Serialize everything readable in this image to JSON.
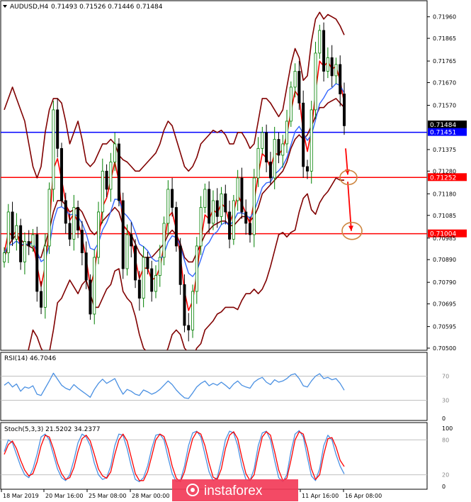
{
  "header": {
    "symbol": "AUDUSD,H4",
    "ohlc": "0.71493 0.71526 0.71446 0.71484",
    "arrow_icon": "triangle-down-icon"
  },
  "rsi_label": "RSI(14) 46.7046",
  "stoch_label": "Stoch(5,3,3) 21.5202 34.2377",
  "watermark": "instaforex",
  "colors": {
    "bull_candle": "#008000",
    "bear_candle": "#000000",
    "bollinger": "#800000",
    "ma_fast": "#ff0000",
    "ma_slow": "#3366ff",
    "level_blue": "#0000ff",
    "level_red": "#ff0000",
    "rsi_line": "#4a90e2",
    "stoch_main": "#4a90e2",
    "stoch_signal": "#ff0000",
    "annotation": "#cd853f",
    "watermark_bg": "#f23b58"
  },
  "chart_data": {
    "type": "candlestick",
    "price_axis": {
      "ylim": [
        0.705,
        0.71984
      ],
      "ticks": [
        "0.71960",
        "0.71865",
        "0.71765",
        "0.71670",
        "0.71570",
        "0.71375",
        "0.71280",
        "0.71180",
        "0.71085",
        "0.70985",
        "0.70890",
        "0.70790",
        "0.70695",
        "0.70595",
        "0.70500"
      ]
    },
    "price_tags": [
      {
        "text": "0.71484",
        "value": 0.71484,
        "style": "black"
      },
      {
        "text": "0.71451",
        "value": 0.71451,
        "style": "blue"
      },
      {
        "text": "0.71252",
        "value": 0.71252,
        "style": "red"
      },
      {
        "text": "0.71004",
        "value": 0.71004,
        "style": "red"
      }
    ],
    "horizontal_levels": [
      {
        "value": 0.71451,
        "color": "blue"
      },
      {
        "value": 0.71252,
        "color": "red"
      },
      {
        "value": 0.71004,
        "color": "red"
      }
    ],
    "time_axis": [
      "18 Mar 2019",
      "20 Mar 16:00",
      "25 Mar 08:00",
      "28 Mar 00:00",
      "11 Apr 16:00",
      "16 Apr 08:00"
    ],
    "closes": [
      0.7092,
      0.711,
      0.7098,
      0.7104,
      0.7088,
      0.7097,
      0.7095,
      0.71,
      0.7075,
      0.7068,
      0.7095,
      0.712,
      0.7155,
      0.7138,
      0.7115,
      0.7105,
      0.7098,
      0.7112,
      0.7102,
      0.7092,
      0.708,
      0.7065,
      0.709,
      0.711,
      0.7128,
      0.712,
      0.7132,
      0.714,
      0.7115,
      0.7085,
      0.71,
      0.7095,
      0.708,
      0.7072,
      0.709,
      0.7085,
      0.7075,
      0.7082,
      0.709,
      0.7105,
      0.712,
      0.7112,
      0.7095,
      0.7078,
      0.706,
      0.7058,
      0.7075,
      0.7095,
      0.7112,
      0.712,
      0.7105,
      0.7115,
      0.7108,
      0.7118,
      0.711,
      0.7098,
      0.7115,
      0.7125,
      0.711,
      0.7105,
      0.71,
      0.7125,
      0.7138,
      0.7145,
      0.7132,
      0.7125,
      0.7142,
      0.7135,
      0.714,
      0.715,
      0.7165,
      0.7172,
      0.7158,
      0.713,
      0.7128,
      0.7155,
      0.718,
      0.719,
      0.7172,
      0.7178,
      0.717,
      0.7175,
      0.7162,
      0.7148
    ],
    "bands": {
      "upper": [
        0.7155,
        0.716,
        0.7165,
        0.716,
        0.7155,
        0.715,
        0.714,
        0.713,
        0.7125,
        0.713,
        0.7145,
        0.7155,
        0.716,
        0.716,
        0.7158,
        0.715,
        0.714,
        0.7145,
        0.715,
        0.7142,
        0.7132,
        0.713,
        0.7132,
        0.7136,
        0.714,
        0.714,
        0.7142,
        0.714,
        0.7135,
        0.7133,
        0.7132,
        0.713,
        0.7128,
        0.7128,
        0.713,
        0.7132,
        0.7134,
        0.7136,
        0.714,
        0.7146,
        0.715,
        0.7148,
        0.7142,
        0.7136,
        0.713,
        0.7128,
        0.713,
        0.7134,
        0.714,
        0.7142,
        0.7144,
        0.7146,
        0.7145,
        0.7146,
        0.7144,
        0.714,
        0.714,
        0.7145,
        0.7145,
        0.7142,
        0.7138,
        0.714,
        0.715,
        0.716,
        0.716,
        0.7158,
        0.7155,
        0.7152,
        0.7155,
        0.7165,
        0.7175,
        0.7182,
        0.7178,
        0.7168,
        0.717,
        0.7185,
        0.7195,
        0.7198,
        0.7195,
        0.7197,
        0.7196,
        0.7195,
        0.7192,
        0.7188
      ],
      "middle": [
        0.709,
        0.7095,
        0.7098,
        0.71,
        0.7098,
        0.7096,
        0.7095,
        0.7094,
        0.709,
        0.709,
        0.7096,
        0.7102,
        0.711,
        0.7115,
        0.7115,
        0.7113,
        0.711,
        0.7111,
        0.7112,
        0.711,
        0.7106,
        0.7102,
        0.71,
        0.7102,
        0.7106,
        0.7108,
        0.711,
        0.7112,
        0.711,
        0.7104,
        0.7102,
        0.71,
        0.7096,
        0.7092,
        0.709,
        0.709,
        0.709,
        0.7092,
        0.7094,
        0.7096,
        0.71,
        0.7102,
        0.71,
        0.7096,
        0.709,
        0.7088,
        0.7088,
        0.7092,
        0.7096,
        0.71,
        0.7102,
        0.7104,
        0.7105,
        0.7106,
        0.7106,
        0.7104,
        0.7104,
        0.7106,
        0.7108,
        0.7108,
        0.7106,
        0.7108,
        0.7112,
        0.7118,
        0.712,
        0.7122,
        0.7124,
        0.7126,
        0.7128,
        0.7132,
        0.7138,
        0.7142,
        0.7144,
        0.7142,
        0.7144,
        0.7148,
        0.7152,
        0.7156,
        0.7156,
        0.7158,
        0.7159,
        0.716,
        0.7158,
        0.7156
      ],
      "lower": [
        0.7025,
        0.7028,
        0.703,
        0.704,
        0.7042,
        0.7042,
        0.705,
        0.7058,
        0.7055,
        0.705,
        0.7047,
        0.7048,
        0.7058,
        0.707,
        0.7072,
        0.7076,
        0.708,
        0.7077,
        0.7074,
        0.7078,
        0.708,
        0.7074,
        0.7068,
        0.7068,
        0.7072,
        0.7076,
        0.7078,
        0.7084,
        0.7085,
        0.7075,
        0.7072,
        0.707,
        0.7064,
        0.7056,
        0.705,
        0.7048,
        0.7046,
        0.7048,
        0.7048,
        0.7046,
        0.705,
        0.7056,
        0.7058,
        0.7056,
        0.705,
        0.7048,
        0.7046,
        0.705,
        0.7052,
        0.7058,
        0.706,
        0.7062,
        0.7065,
        0.7066,
        0.7068,
        0.7068,
        0.7068,
        0.7067,
        0.7071,
        0.7074,
        0.7074,
        0.7076,
        0.7074,
        0.7076,
        0.708,
        0.7086,
        0.7093,
        0.71,
        0.7101,
        0.7099,
        0.7101,
        0.7102,
        0.711,
        0.7116,
        0.7118,
        0.7111,
        0.7109,
        0.7114,
        0.7117,
        0.7119,
        0.7122,
        0.7125,
        0.7124,
        0.7124
      ]
    },
    "forecast_arrows": [
      {
        "from_value": 0.7138,
        "to_value": 0.71252
      },
      {
        "from_value": 0.71252,
        "to_value": 0.71004
      }
    ],
    "rsi": {
      "label": "RSI(14) 46.7046",
      "ticks": [
        "70",
        "30",
        "0"
      ],
      "ylim": [
        0,
        100
      ],
      "values": [
        55,
        60,
        52,
        57,
        45,
        52,
        50,
        54,
        40,
        38,
        50,
        62,
        75,
        65,
        55,
        50,
        47,
        56,
        50,
        45,
        40,
        35,
        48,
        58,
        65,
        58,
        62,
        66,
        52,
        40,
        48,
        45,
        40,
        38,
        47,
        44,
        40,
        43,
        48,
        55,
        62,
        56,
        47,
        40,
        34,
        33,
        42,
        52,
        58,
        62,
        54,
        58,
        55,
        60,
        55,
        49,
        57,
        62,
        55,
        52,
        50,
        60,
        65,
        68,
        60,
        56,
        64,
        60,
        62,
        66,
        72,
        74,
        66,
        54,
        52,
        62,
        70,
        74,
        66,
        68,
        64,
        66,
        58,
        46.7
      ]
    },
    "stochastic": {
      "label": "Stoch(5,3,3) 21.5202 34.2377",
      "ticks": [
        "100",
        "80",
        "20",
        "0"
      ],
      "ylim": [
        0,
        100
      ],
      "main": [
        60,
        80,
        75,
        55,
        35,
        20,
        15,
        30,
        55,
        85,
        90,
        80,
        55,
        30,
        15,
        10,
        20,
        45,
        75,
        90,
        85,
        70,
        40,
        20,
        12,
        15,
        35,
        70,
        90,
        88,
        65,
        35,
        12,
        8,
        15,
        35,
        65,
        88,
        90,
        80,
        50,
        22,
        8,
        10,
        35,
        70,
        92,
        95,
        85,
        55,
        25,
        10,
        15,
        45,
        80,
        95,
        92,
        70,
        35,
        12,
        10,
        30,
        70,
        92,
        95,
        80,
        45,
        15,
        8,
        20,
        60,
        90,
        96,
        85,
        50,
        18,
        10,
        30,
        70,
        88,
        80,
        55,
        35,
        21.5
      ],
      "signal": [
        55,
        72,
        78,
        65,
        45,
        28,
        18,
        22,
        42,
        70,
        88,
        85,
        65,
        40,
        22,
        12,
        15,
        32,
        60,
        82,
        88,
        78,
        55,
        30,
        18,
        14,
        25,
        55,
        80,
        90,
        78,
        50,
        22,
        10,
        10,
        25,
        52,
        80,
        90,
        86,
        65,
        35,
        14,
        8,
        25,
        55,
        82,
        94,
        90,
        70,
        40,
        16,
        12,
        30,
        65,
        88,
        94,
        82,
        50,
        22,
        10,
        20,
        55,
        85,
        94,
        88,
        60,
        28,
        10,
        14,
        45,
        80,
        94,
        90,
        65,
        30,
        12,
        20,
        55,
        82,
        84,
        68,
        45,
        34.2
      ]
    }
  }
}
